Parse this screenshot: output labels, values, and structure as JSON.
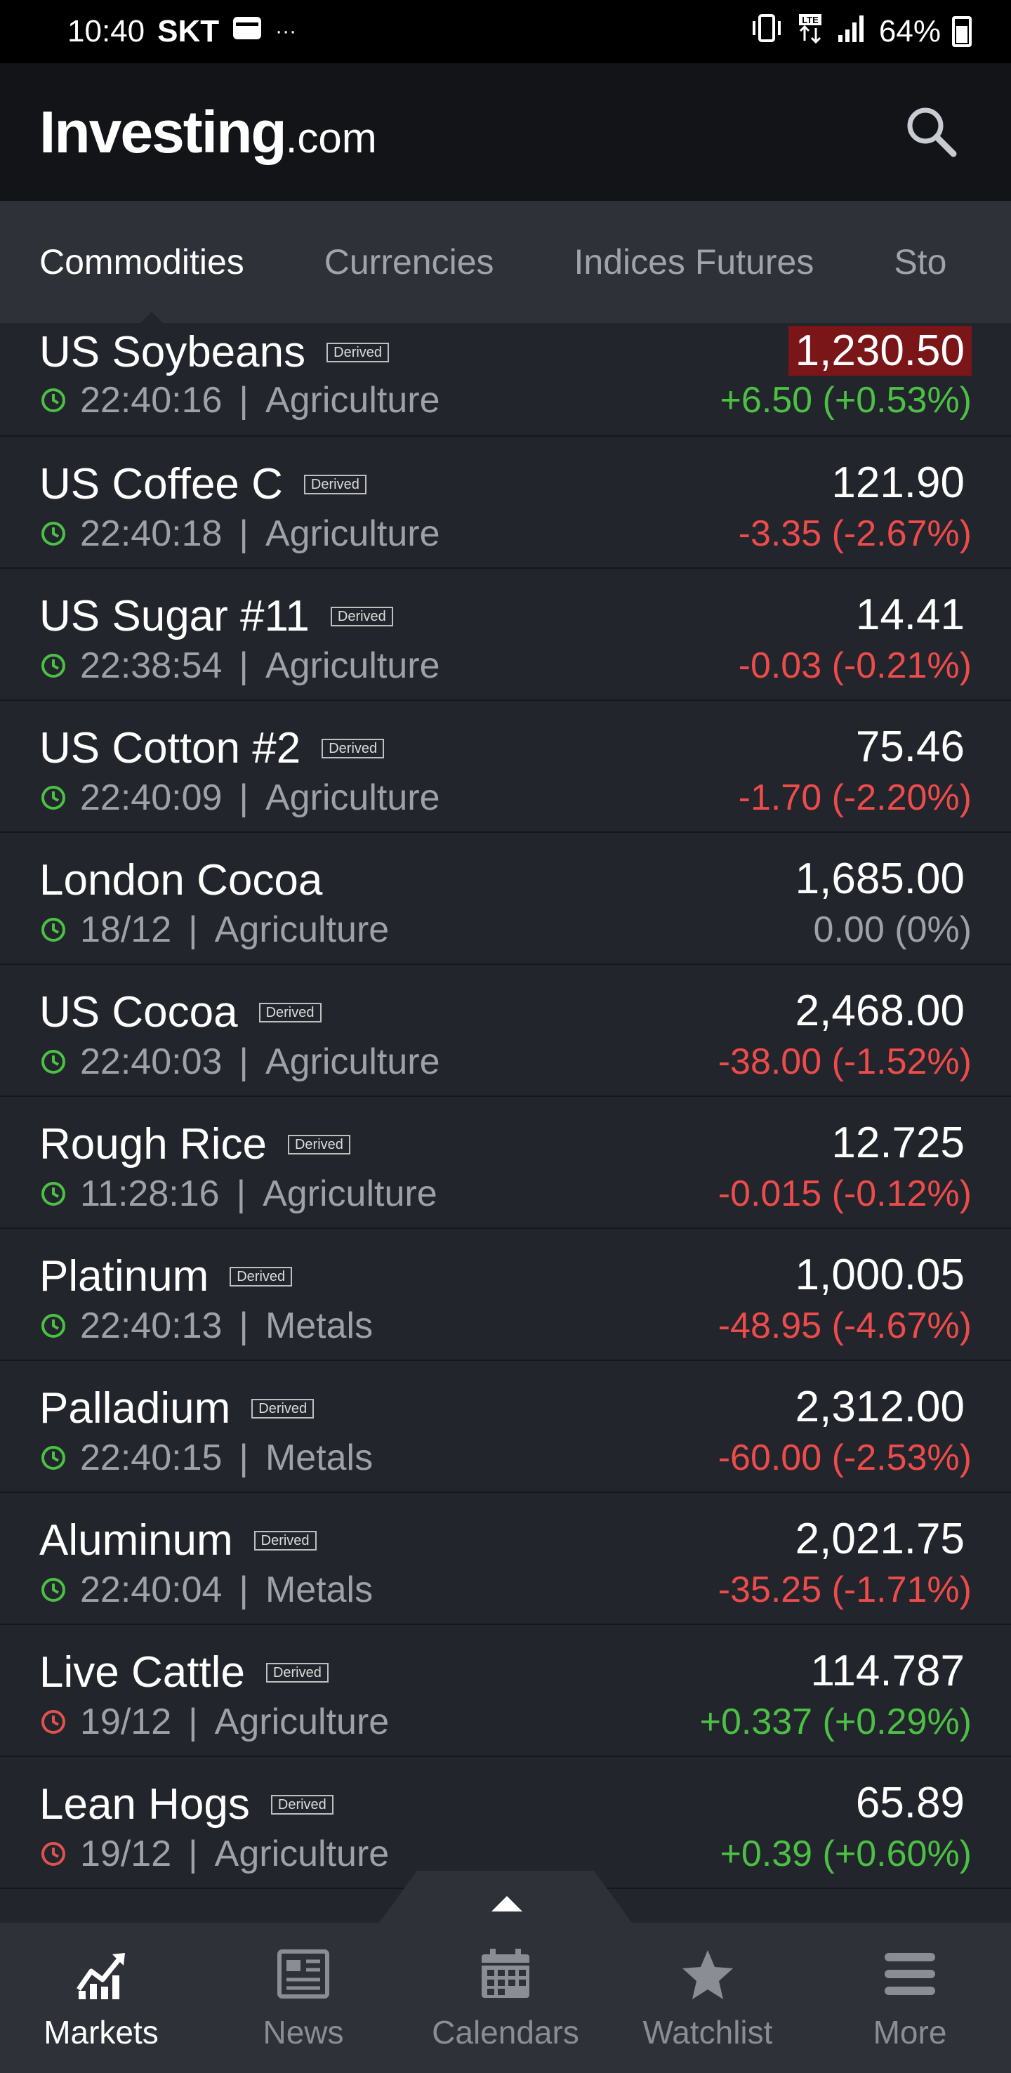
{
  "status_bar": {
    "time": "10:40",
    "carrier": "SKT",
    "dots": "···",
    "battery": "64%"
  },
  "header": {
    "logo_main": "Investing",
    "logo_suffix": ".com",
    "search_icon": "search-icon"
  },
  "tabs": [
    {
      "label": "Commodities",
      "active": true
    },
    {
      "label": "Currencies",
      "active": false
    },
    {
      "label": "Indices Futures",
      "active": false
    },
    {
      "label": "Sto",
      "active": false
    }
  ],
  "rows": [
    {
      "name": "US Soybeans",
      "derived": "Derived",
      "time": "22:40:16",
      "category": "Agriculture",
      "price": "1,230.50",
      "change": "+6.50 (+0.53%)",
      "dir": "up",
      "clock": "green",
      "flash": true
    },
    {
      "name": "US Coffee C",
      "derived": "Derived",
      "time": "22:40:18",
      "category": "Agriculture",
      "price": "121.90",
      "change": "-3.35 (-2.67%)",
      "dir": "down",
      "clock": "green",
      "flash": false
    },
    {
      "name": "US Sugar #11",
      "derived": "Derived",
      "time": "22:38:54",
      "category": "Agriculture",
      "price": "14.41",
      "change": "-0.03 (-0.21%)",
      "dir": "down",
      "clock": "green",
      "flash": false
    },
    {
      "name": "US Cotton #2",
      "derived": "Derived",
      "time": "22:40:09",
      "category": "Agriculture",
      "price": "75.46",
      "change": "-1.70 (-2.20%)",
      "dir": "down",
      "clock": "green",
      "flash": false
    },
    {
      "name": "London Cocoa",
      "derived": "",
      "time": "18/12",
      "category": "Agriculture",
      "price": "1,685.00",
      "change": "0.00 (0%)",
      "dir": "flat",
      "clock": "green",
      "flash": false
    },
    {
      "name": "US Cocoa",
      "derived": "Derived",
      "time": "22:40:03",
      "category": "Agriculture",
      "price": "2,468.00",
      "change": "-38.00 (-1.52%)",
      "dir": "down",
      "clock": "green",
      "flash": false
    },
    {
      "name": "Rough Rice",
      "derived": "Derived",
      "time": "11:28:16",
      "category": "Agriculture",
      "price": "12.725",
      "change": "-0.015 (-0.12%)",
      "dir": "down",
      "clock": "green",
      "flash": false
    },
    {
      "name": "Platinum",
      "derived": "Derived",
      "time": "22:40:13",
      "category": "Metals",
      "price": "1,000.05",
      "change": "-48.95 (-4.67%)",
      "dir": "down",
      "clock": "green",
      "flash": false
    },
    {
      "name": "Palladium",
      "derived": "Derived",
      "time": "22:40:15",
      "category": "Metals",
      "price": "2,312.00",
      "change": "-60.00 (-2.53%)",
      "dir": "down",
      "clock": "green",
      "flash": false
    },
    {
      "name": "Aluminum",
      "derived": "Derived",
      "time": "22:40:04",
      "category": "Metals",
      "price": "2,021.75",
      "change": "-35.25 (-1.71%)",
      "dir": "down",
      "clock": "green",
      "flash": false
    },
    {
      "name": "Live Cattle",
      "derived": "Derived",
      "time": "19/12",
      "category": "Agriculture",
      "price": "114.787",
      "change": "+0.337 (+0.29%)",
      "dir": "up",
      "clock": "red",
      "flash": false
    },
    {
      "name": "Lean Hogs",
      "derived": "Derived",
      "time": "19/12",
      "category": "Agriculture",
      "price": "65.89",
      "change": "+0.39 (+0.60%)",
      "dir": "up",
      "clock": "red",
      "flash": false
    }
  ],
  "bottom_nav": [
    {
      "label": "Markets",
      "icon": "markets-chart-icon",
      "active": true
    },
    {
      "label": "News",
      "icon": "newspaper-icon",
      "active": false
    },
    {
      "label": "Calendars",
      "icon": "calendar-icon",
      "active": false
    },
    {
      "label": "Watchlist",
      "icon": "star-icon",
      "active": false
    },
    {
      "label": "More",
      "icon": "menu-icon",
      "active": false
    }
  ],
  "colors": {
    "up": "#4cc045",
    "down": "#ee4b4b",
    "flat": "#9ea2a8",
    "flash": "#7a1518"
  }
}
